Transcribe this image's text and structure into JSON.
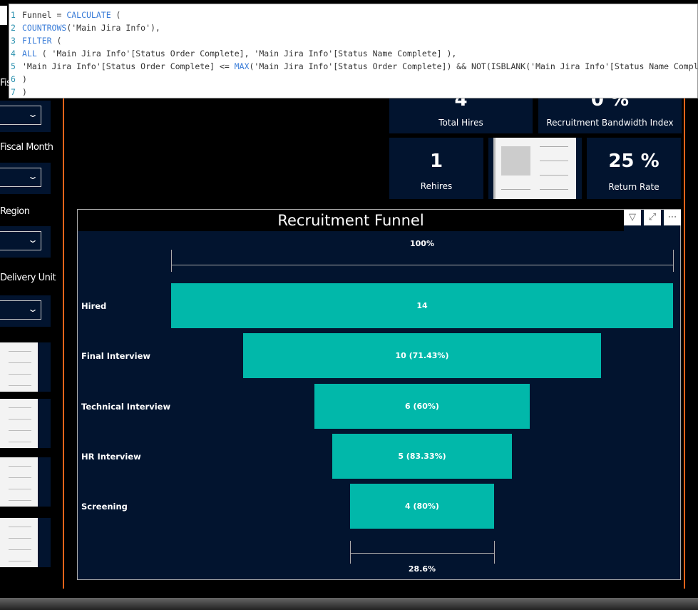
{
  "code_editor": {
    "lines": [
      {
        "n": "1",
        "text": "Funnel = ",
        "kw": "CALCULATE",
        "rest": " ("
      },
      {
        "n": "2",
        "text": "",
        "kw": "COUNTROWS",
        "rest": "('Main Jira Info'),"
      },
      {
        "n": "3",
        "text": "",
        "kw": "FILTER",
        "rest": " ("
      },
      {
        "n": "4",
        "text": "",
        "kw": "ALL",
        "rest": " ( 'Main Jira Info'[Status Order Complete], 'Main Jira Info'[Status Name Complete] ),"
      },
      {
        "n": "5",
        "text": "'Main Jira Info'[Status Order Complete] <= ",
        "kw": "MAX",
        "rest": "('Main Jira Info'[Status Order Complete]) && NOT(ISBLANK('Main Jira Info'[Status Name Complete]))"
      },
      {
        "n": "6",
        "text": ")",
        "kw": "",
        "rest": ""
      },
      {
        "n": "7",
        "text": ")",
        "kw": "",
        "rest": ""
      }
    ]
  },
  "slicers": {
    "first_label": "Fis",
    "fiscal_month": "Fiscal Month",
    "region": "Region",
    "delivery_unit": "Delivery Unit",
    "chevron": "chevron-down-icon"
  },
  "kpis": {
    "total_hires": {
      "value": "4",
      "label": "Total Hires"
    },
    "bandwidth": {
      "value": "0 %",
      "label": "Recruitment Bandwidth Index"
    },
    "rehires": {
      "value": "1",
      "label": "Rehires"
    },
    "return_rate": {
      "value": "25 %",
      "label": "Return Rate"
    }
  },
  "visual_header": {
    "icons": [
      "filter-icon",
      "focus-mode-icon",
      "more-options-icon"
    ],
    "more": "⋯"
  },
  "chart_data": {
    "type": "funnel",
    "title": "Recruitment Funnel",
    "categories": [
      "Hired",
      "Final Interview",
      "Technical Interview",
      "HR Interview",
      "Screening"
    ],
    "values": [
      14,
      10,
      6,
      5,
      4
    ],
    "data_labels": [
      "14",
      "10 (71.43%)",
      "6 (60%)",
      "5 (83.33%)",
      "4 (80%)"
    ],
    "top_label": "100%",
    "bottom_label": "28.6%",
    "bar_color": "#01B8AA",
    "background": "#02142F"
  }
}
